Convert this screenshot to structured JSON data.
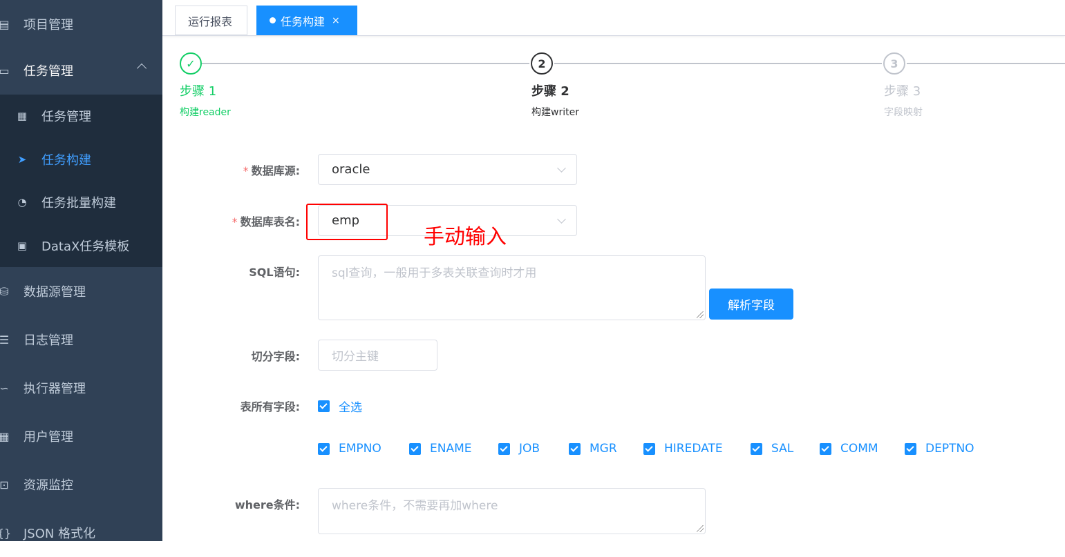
{
  "sidebar": {
    "items": [
      {
        "label": "项目管理",
        "icon": "project-icon"
      },
      {
        "label": "任务管理",
        "icon": "monitor-icon"
      },
      {
        "label": "数据源管理",
        "icon": "database-icon"
      },
      {
        "label": "日志管理",
        "icon": "log-icon"
      },
      {
        "label": "执行器管理",
        "icon": "executor-icon"
      },
      {
        "label": "用户管理",
        "icon": "user-table-icon"
      },
      {
        "label": "资源监控",
        "icon": "monitor-resource-icon"
      },
      {
        "label": "JSON 格式化",
        "icon": "braces-icon"
      }
    ],
    "submenu": [
      {
        "label": "任务管理",
        "icon": "calendar-icon"
      },
      {
        "label": "任务构建",
        "icon": "paper-plane-icon"
      },
      {
        "label": "任务批量构建",
        "icon": "dashboard-icon"
      },
      {
        "label": "DataX任务模板",
        "icon": "clipboard-icon"
      }
    ]
  },
  "tabs": {
    "report": "运行报表",
    "build": "任务构建",
    "close": "×"
  },
  "steps": [
    {
      "index": "✓",
      "title": "步骤 1",
      "desc": "构建reader",
      "status": "done"
    },
    {
      "index": "2",
      "title": "步骤 2",
      "desc": "构建writer",
      "status": "process"
    },
    {
      "index": "3",
      "title": "步骤 3",
      "desc": "字段映射",
      "status": "wait"
    }
  ],
  "form": {
    "required_mark": "*",
    "datasource_label": "数据库源:",
    "datasource_value": "oracle",
    "table_label": "数据库表名:",
    "table_value": "emp",
    "sql_label": "SQL语句:",
    "sql_placeholder": "sql查询，一般用于多表关联查询时才用",
    "parse_button": "解析字段",
    "split_label": "切分字段:",
    "split_placeholder": "切分主键",
    "fields_label": "表所有字段:",
    "select_all": "全选",
    "fields": [
      "EMPNO",
      "ENAME",
      "JOB",
      "MGR",
      "HIREDATE",
      "SAL",
      "COMM",
      "DEPTNO"
    ],
    "where_label": "where条件:",
    "where_placeholder": "where条件，不需要再加where"
  },
  "annotation": {
    "text": "手动输入",
    "color": "#ff0000"
  },
  "colors": {
    "sidebar_bg": "#304156",
    "submenu_bg": "#1f2d3d",
    "primary": "#1890ff",
    "success": "#13ce66"
  }
}
